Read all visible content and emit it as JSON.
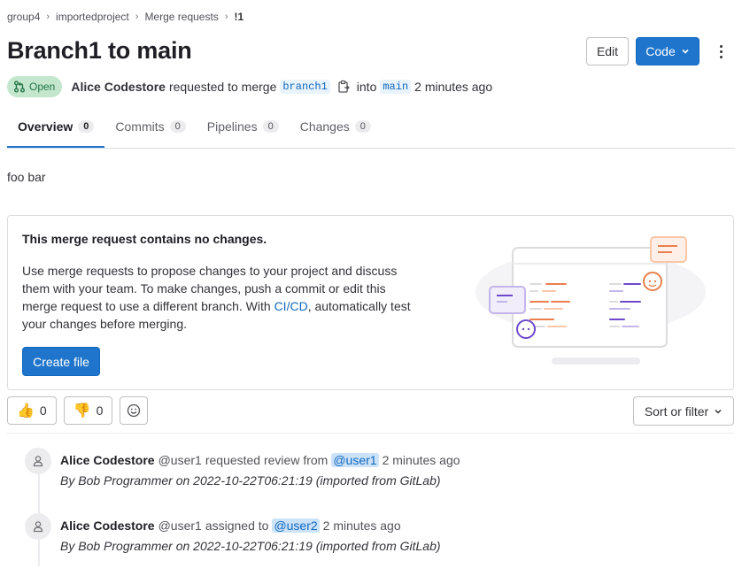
{
  "breadcrumb": [
    "group4",
    "importedproject",
    "Merge requests",
    "!1"
  ],
  "title": "Branch1 to main",
  "header_actions": {
    "edit": "Edit",
    "code": "Code"
  },
  "status": {
    "label": "Open",
    "color": "#217645"
  },
  "meta": {
    "author": "Alice Codestore",
    "requested_text": "requested to merge",
    "source_branch": "branch1",
    "into_text": "into",
    "target_branch": "main",
    "time": "2 minutes ago"
  },
  "tabs": [
    {
      "label": "Overview",
      "count": "0"
    },
    {
      "label": "Commits",
      "count": "0"
    },
    {
      "label": "Pipelines",
      "count": "0"
    },
    {
      "label": "Changes",
      "count": "0"
    }
  ],
  "description": "foo bar",
  "empty_state": {
    "title": "This merge request contains no changes.",
    "text_before_link": "Use merge requests to propose changes to your project and discuss them with your team. To make changes, push a commit or edit this merge request to use a different branch. With ",
    "link": "CI/CD",
    "text_after_link": ", automatically test your changes before merging.",
    "button": "Create file"
  },
  "reactions": {
    "thumbs_up": "0",
    "thumbs_down": "0"
  },
  "sort_filter": "Sort or filter",
  "activity": [
    {
      "author": "Alice Codestore",
      "handle": "@user1",
      "action": "requested review from",
      "mention": "@user1",
      "time": "2 minutes ago",
      "note": "By Bob Programmer on 2022-10-22T06:21:19 (imported from GitLab)"
    },
    {
      "author": "Alice Codestore",
      "handle": "@user1",
      "action": "assigned to",
      "mention": "@user2",
      "time": "2 minutes ago",
      "note": "By Bob Programmer on 2022-10-22T06:21:19 (imported from GitLab)"
    }
  ],
  "colors": {
    "primary": "#1f75cb",
    "open_bg": "#c3e6cd",
    "mention_bg": "#cbe2f9"
  }
}
